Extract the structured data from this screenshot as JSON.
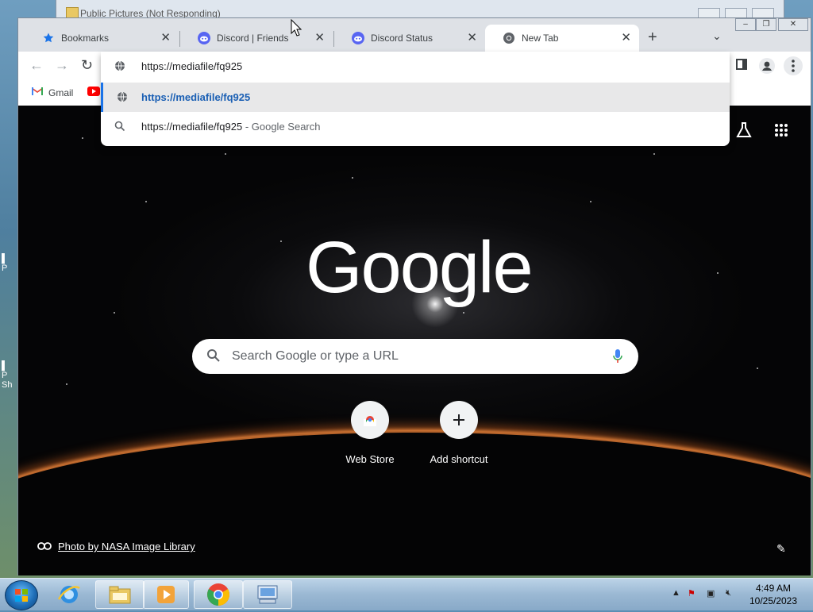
{
  "background_window": {
    "title": "Public Pictures (Not Responding)"
  },
  "tabs": [
    {
      "label": "Bookmarks",
      "icon": "star-icon",
      "active": false
    },
    {
      "label": "Discord | Friends",
      "icon": "discord-icon",
      "active": false
    },
    {
      "label": "Discord Status",
      "icon": "discord-icon",
      "active": false
    },
    {
      "label": "New Tab",
      "icon": "chrome-icon",
      "active": true
    }
  ],
  "omnibox": {
    "input_value": "https://mediafile/fq925",
    "suggestions": [
      {
        "text": "https://mediafile/fq925",
        "suffix": "",
        "icon": "globe-icon",
        "selected": true
      },
      {
        "text": "https://mediafile/fq925",
        "suffix": " - Google Search",
        "icon": "search-icon",
        "selected": false
      }
    ]
  },
  "bookmarks": [
    {
      "label": "Gmail",
      "icon": "gmail-icon"
    },
    {
      "label": "",
      "icon": "youtube-icon"
    }
  ],
  "newtab": {
    "logo": "Google",
    "search_placeholder": "Search Google or type a URL",
    "shortcuts": [
      {
        "label": "Web Store",
        "icon": "webstore-icon"
      },
      {
        "label": "Add shortcut",
        "icon": "plus-icon"
      }
    ],
    "photo_credit": "Photo by NASA Image Library"
  },
  "taskbar": {
    "time": "4:49 AM",
    "date": "10/25/2023",
    "items": [
      "internet-explorer-icon",
      "file-explorer-icon",
      "media-player-icon",
      "chrome-icon",
      "remote-desktop-icon"
    ]
  },
  "colors": {
    "accent": "#1a73e8",
    "tab_strip": "#dee1e6",
    "selected_text": "#1a5fb4"
  }
}
